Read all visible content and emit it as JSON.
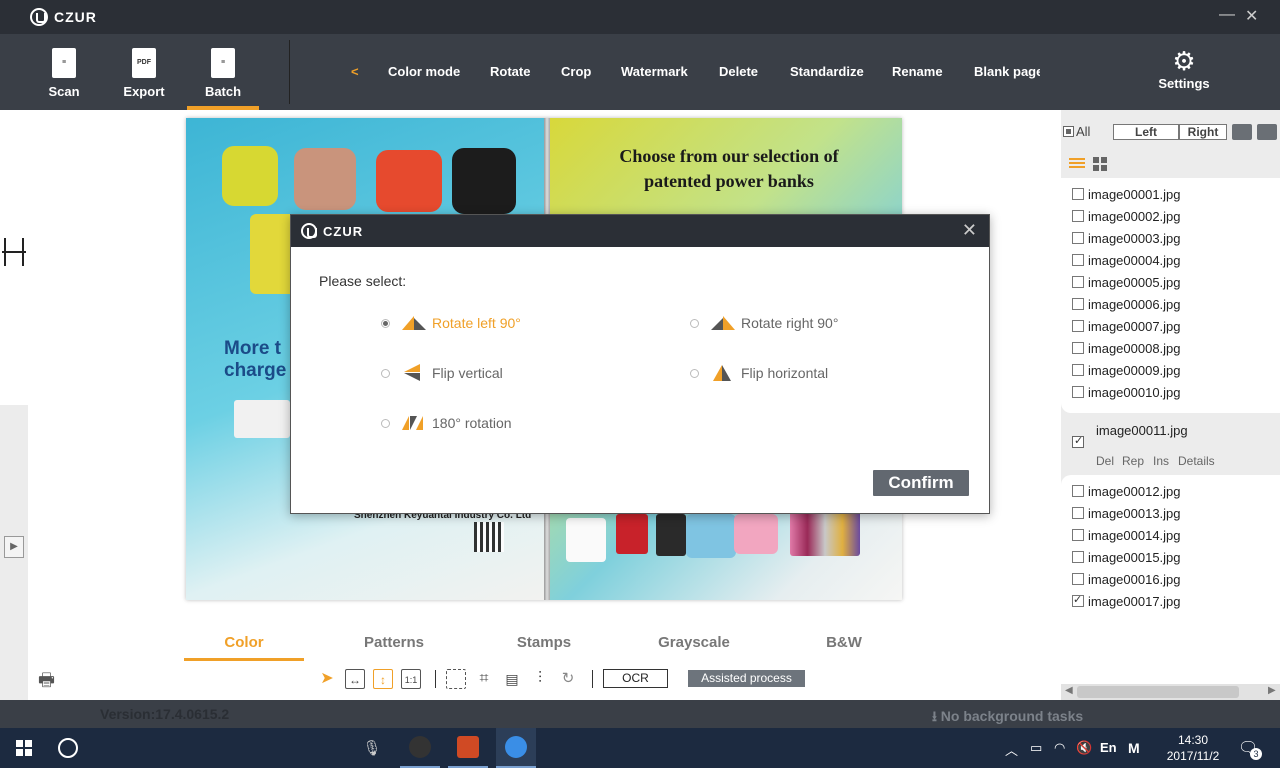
{
  "app": {
    "logo_text": "CZUR"
  },
  "toolbar": {
    "tools": [
      {
        "label": "Scan",
        "icon": "scan-document-icon"
      },
      {
        "label": "Export",
        "icon": "pdf-export-icon",
        "icon_text": "PDF"
      },
      {
        "label": "Batch",
        "icon": "batch-document-icon"
      }
    ],
    "active_tool": "Batch",
    "back_arrow": "<",
    "menu": [
      "Color mode",
      "Rotate",
      "Crop",
      "Watermark",
      "Delete",
      "Standardize",
      "Rename",
      "Blank page"
    ],
    "settings_label": "Settings"
  },
  "preview": {
    "heading_line1": "Choose from our selection of",
    "heading_line2": "patented power banks",
    "left_text_line1": "More t",
    "left_text_line2": "charge",
    "company": "Shenzhen Keyuantai Industry Co. Ltd"
  },
  "dialog": {
    "logo_text": "CZUR",
    "prompt": "Please select:",
    "options": [
      {
        "label": "Rotate left 90°",
        "selected": true,
        "icon": "rotate-left-icon"
      },
      {
        "label": "Rotate right 90°",
        "selected": false,
        "icon": "rotate-right-icon"
      },
      {
        "label": "Flip vertical",
        "selected": false,
        "icon": "flip-vertical-icon"
      },
      {
        "label": "Flip horizontal",
        "selected": false,
        "icon": "flip-horizontal-icon"
      },
      {
        "label": "180° rotation",
        "selected": false,
        "icon": "rotate-180-icon"
      }
    ],
    "confirm_label": "Confirm"
  },
  "bottom_tabs": {
    "items": [
      "Color",
      "Patterns",
      "Stamps",
      "Grayscale",
      "B&W"
    ],
    "active": "Color"
  },
  "bottom_tools": {
    "one_to_one": "1:1",
    "ocr_label": "OCR",
    "assist_label": "Assisted process"
  },
  "right_panel": {
    "all_label": "All",
    "left_label": "Left",
    "right_label": "Right",
    "files_top": [
      {
        "name": "image00001.jpg",
        "checked": false
      },
      {
        "name": "image00002.jpg",
        "checked": false
      },
      {
        "name": "image00003.jpg",
        "checked": false
      },
      {
        "name": "image00004.jpg",
        "checked": false
      },
      {
        "name": "image00005.jpg",
        "checked": false
      },
      {
        "name": "image00006.jpg",
        "checked": false
      },
      {
        "name": "image00007.jpg",
        "checked": false
      },
      {
        "name": "image00008.jpg",
        "checked": false
      },
      {
        "name": "image00009.jpg",
        "checked": false
      },
      {
        "name": "image00010.jpg",
        "checked": false
      }
    ],
    "selected_file": {
      "name": "image00011.jpg",
      "checked": true,
      "actions": [
        "Del",
        "Rep",
        "Ins",
        "Details"
      ]
    },
    "files_bottom": [
      {
        "name": "image00012.jpg",
        "checked": false
      },
      {
        "name": "image00013.jpg",
        "checked": false
      },
      {
        "name": "image00014.jpg",
        "checked": false
      },
      {
        "name": "image00015.jpg",
        "checked": false
      },
      {
        "name": "image00016.jpg",
        "checked": false
      },
      {
        "name": "image00017.jpg",
        "checked": true
      }
    ]
  },
  "status": {
    "version": "Version:17.4.0615.2",
    "background_tasks": "No background tasks"
  },
  "taskbar": {
    "lang": "En",
    "ime": "M",
    "time": "14:30",
    "date": "2017/11/2",
    "notification_count": "3"
  },
  "colors": {
    "accent": "#f0a028",
    "title_bar": "#2b2f36",
    "toolbar": "#3a3f47",
    "taskbar": "#1c2a40"
  }
}
